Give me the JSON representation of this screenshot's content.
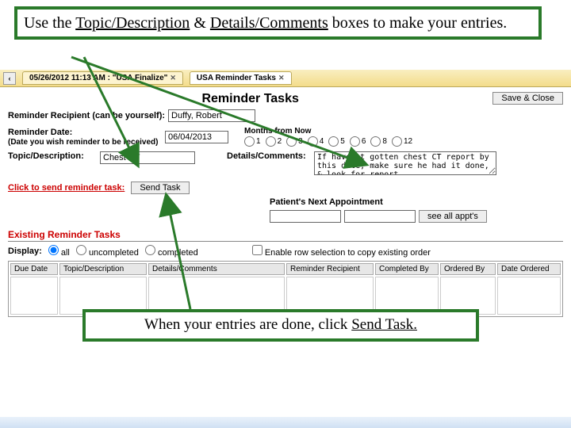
{
  "callouts": {
    "top_a": "Use the ",
    "top_b": "Topic/Description",
    "top_c": " & ",
    "top_d": "Details/Comments",
    "top_e": " boxes to make your entries.",
    "bottom_a": "When your entries are done, click ",
    "bottom_b": "Send Task."
  },
  "tabbar": {
    "nav_back": "‹",
    "tab1": "05/26/2012 11:13 AM : \"USA Finalize\"",
    "tab2": "USA Reminder Tasks",
    "close": "✕"
  },
  "page": {
    "title": "Reminder Tasks",
    "save_close": "Save & Close",
    "recipient_label": "Reminder Recipient (can be yourself):",
    "recipient_value": "Duffy, Robert",
    "months_label": "Months from Now",
    "date_label": "Reminder Date:",
    "date_sub": "(Date you wish reminder to be received)",
    "date_value": "06/04/2013",
    "months_opts": [
      "1",
      "2",
      "3",
      "4",
      "5",
      "6",
      "8",
      "12"
    ],
    "topic_label": "Topic/Description:",
    "topic_value": "Chest CT",
    "details_label": "Details/Comments:",
    "details_value": "If haven't gotten chest CT report by this date, make sure he had it done, & look for report.",
    "send_label": "Click to send reminder task:",
    "send_btn": "Send Task",
    "next_appt_label": "Patient's Next Appointment",
    "see_all": "see all appt's",
    "existing_heading": "Existing Reminder Tasks",
    "display_label": "Display:",
    "display_all": "all",
    "display_uncompleted": "uncompleted",
    "display_completed": "completed",
    "enable_row": "Enable row selection to copy existing order",
    "cols": {
      "due": "Due Date",
      "topic": "Topic/Description",
      "details": "Details/Comments",
      "recip": "Reminder Recipient",
      "compby": "Completed By",
      "ordby": "Ordered By",
      "dateord": "Date Ordered"
    }
  }
}
